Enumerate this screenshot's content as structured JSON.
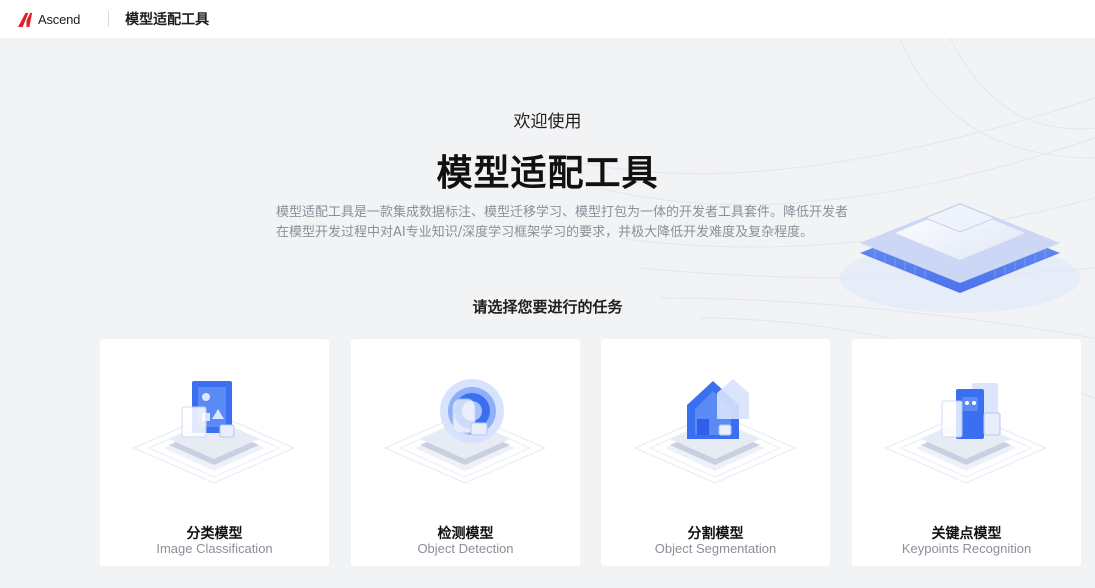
{
  "header": {
    "logo_text": "Ascend",
    "title": "模型适配工具"
  },
  "hero": {
    "welcome": "欢迎使用",
    "title": "模型适配工具",
    "description_line1": "模型适配工具是一款集成数据标注、模型迁移学习、模型打包为一体的开发者工具套件。降低开发者",
    "description_line2": "在模型开发过程中对AI专业知识/深度学习框架学习的要求，并极大降低开发难度及复杂程度。"
  },
  "task_prompt": "请选择您要进行的任务",
  "cards": [
    {
      "title": "分类模型",
      "subtitle": "Image Classification",
      "icon": "image-classification-icon"
    },
    {
      "title": "检测模型",
      "subtitle": "Object Detection",
      "icon": "object-detection-icon"
    },
    {
      "title": "分割模型",
      "subtitle": "Object Segmentation",
      "icon": "object-segmentation-icon"
    },
    {
      "title": "关键点模型",
      "subtitle": "Keypoints Recognition",
      "icon": "keypoints-recognition-icon"
    }
  ],
  "colors": {
    "accent_blue": "#3a6ff0",
    "logo_red": "#e0202a",
    "background": "#f2f3f5"
  }
}
